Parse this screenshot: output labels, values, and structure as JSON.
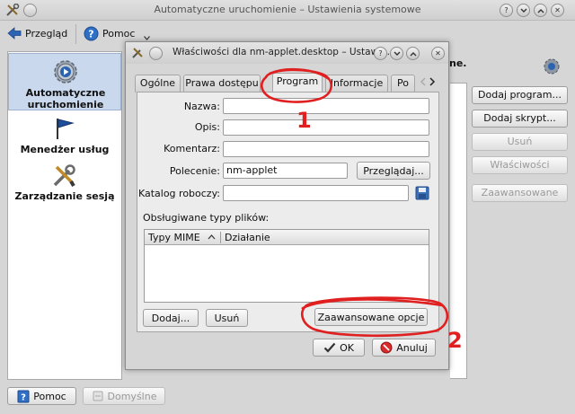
{
  "window": {
    "title": "Automatyczne uruchomienie – Ustawienia systemowe"
  },
  "toolbar": {
    "overview_label": "Przegląd",
    "help_label": "Pomoc"
  },
  "sidebar": {
    "items": [
      {
        "label": "Automatyczne uruchomienie",
        "icon": "autostart-gear-icon",
        "active": true
      },
      {
        "label": "Menedżer usług",
        "icon": "flag-icon",
        "active": false
      },
      {
        "label": "Zarządzanie sesją",
        "icon": "tools-icon",
        "active": false
      }
    ]
  },
  "main": {
    "heading_fragment": "ne.",
    "buttons": [
      {
        "label": "Dodaj program...",
        "enabled": true
      },
      {
        "label": "Dodaj skrypt...",
        "enabled": true
      },
      {
        "label": "Usuń",
        "enabled": false
      },
      {
        "label": "Właściwości",
        "enabled": false
      },
      {
        "label": "Zaawansowane",
        "enabled": false
      }
    ]
  },
  "bottom": {
    "help_label": "Pomoc",
    "defaults_label": "Domyślne"
  },
  "dialog": {
    "title": "Właściwości dla nm-applet.desktop – Ustawie...",
    "tabs": [
      "Ogólne",
      "Prawa dostępu",
      "Program",
      "Informacje",
      "Po"
    ],
    "active_tab": "Program",
    "fields": {
      "name_label": "Nazwa:",
      "name_value": "",
      "desc_label": "Opis:",
      "desc_value": "",
      "comment_label": "Komentarz:",
      "comment_value": "",
      "command_label": "Polecenie:",
      "command_value": "nm-applet",
      "browse_label": "Przeglądaj...",
      "workdir_label": "Katalog roboczy:",
      "workdir_value": ""
    },
    "mime": {
      "section_label": "Obsługiwane typy plików:",
      "col_type": "Typy MIME",
      "col_action": "Działanie",
      "add_label": "Dodaj...",
      "remove_label": "Usuń",
      "advanced_label": "Zaawansowane opcje"
    },
    "ok_label": "OK",
    "cancel_label": "Anuluj"
  },
  "annotations": {
    "first": "1",
    "second": "2",
    "color": "#e02020"
  }
}
